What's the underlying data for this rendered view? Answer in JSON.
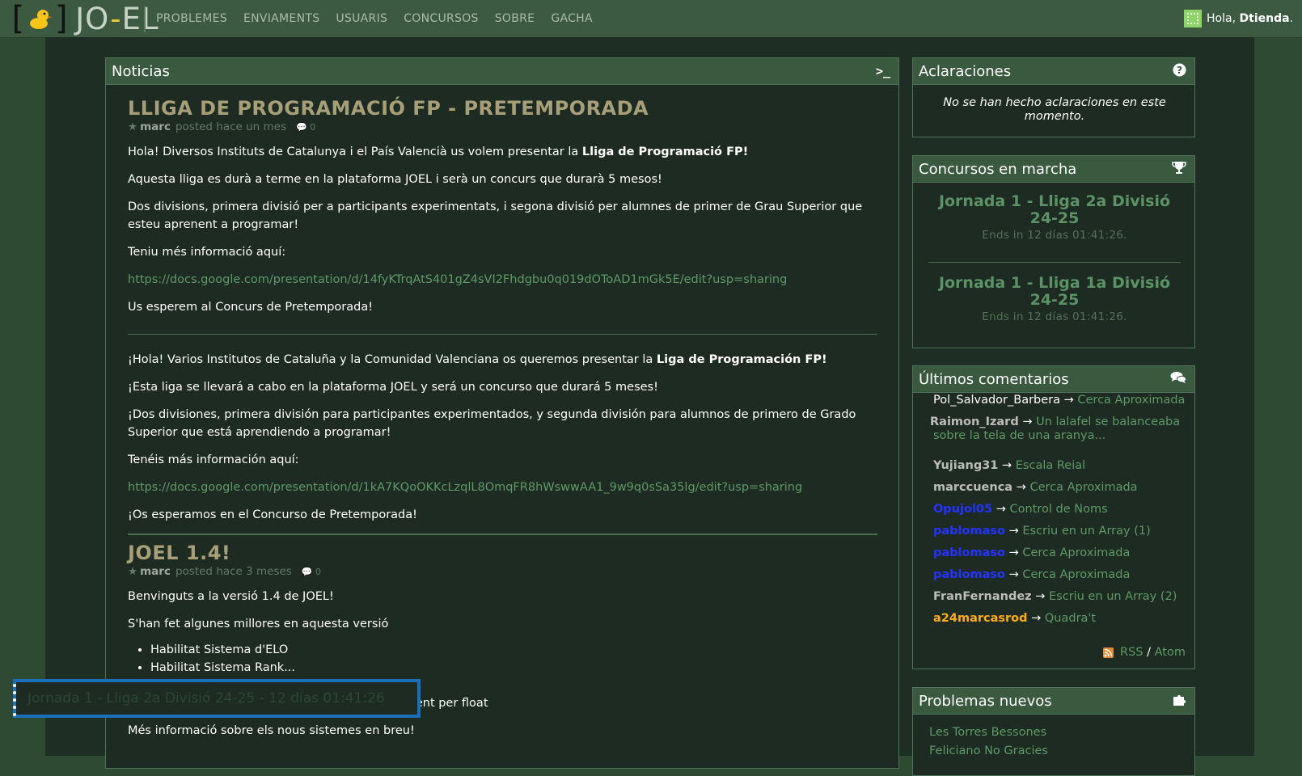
{
  "nav": {
    "logo_left": "[",
    "logo_right": "]",
    "logo_text_a": "JO",
    "logo_text_dash": "-",
    "logo_text_b": "EL",
    "links": [
      "PROBLEMES",
      "ENVIAMENTS",
      "USUARIS",
      "CONCURSOS",
      "SOBRE",
      "GACHA"
    ],
    "greeting": "Hola, ",
    "username": "Dtienda",
    "greeting_end": "."
  },
  "news": {
    "title": "Noticias",
    "icon": "terminal-icon",
    "post1": {
      "title": "LLIGA DE PROGRAMACIÓ FP - PRETEMPORADA",
      "author": "marc",
      "posted": "posted hace un mes",
      "comments": "0",
      "p1_a": "Hola! Diversos Instituts de Catalunya i el País Valencià us volem presentar la ",
      "p1_b": "Lliga de Programació FP!",
      "p2": "Aquesta lliga es durà a terme en la plataforma JOEL i serà un concurs que durarà 5 mesos!",
      "p3": "Dos divisions, primera divisió per a participants experimentats, i segona divisió per alumnes de primer de Grau Superior que esteu aprenent a programar!",
      "p4": "Teniu més informació aquí:",
      "link1": "https://docs.google.com/presentation/d/14fyKTrqAtS401gZ4sVI2Fhdgbu0q019dOToAD1mGk5E/edit?usp=sharing",
      "p5": "Us esperem al Concurs de Pretemporada!",
      "es1_a": "¡Hola! Varios Institutos de Cataluña y la Comunidad Valenciana os queremos presentar la ",
      "es1_b": "Liga de Programación FP!",
      "es2": "¡Esta liga se llevará a cabo en la plataforma JOEL y será un concurso que durará 5 meses!",
      "es3": "¡Dos divisiones, primera división para participantes experimentados, y segunda división para alumnos de primero de Grado Superior que está aprendiendo a programar!",
      "es4": "Tenéis más información aquí:",
      "link2": "https://docs.google.com/presentation/d/1kA7KQoOKKcLzqlL8OmqFR8hWswwAA1_9w9q0sSa35lg/edit?usp=sharing",
      "es5": "¡Os esperamos en el Concurso de Pretemporada!"
    },
    "post2": {
      "title": "JOEL 1.4!",
      "author": "marc",
      "posted": "posted hace 3 meses",
      "comments": "0",
      "p1": "Benvinguts a la versió 1.4 de JOEL!",
      "p2": "S'han fet algunes millores en aquesta versió",
      "items": [
        "Habilitat Sistema d'ELO",
        "Habilitat Sistema Rank...",
        "...",
        "...ent per float"
      ],
      "p3": "Més informació sobre els nous sistemes en breu!"
    }
  },
  "floating": {
    "text": "Jornada 1 - Lliga 2a Divisió 24-25 - 12 días 01:41:26"
  },
  "clarifications": {
    "title": "Aclaraciones",
    "icon": "question-icon",
    "text": "No se han hecho aclaraciones en este momento."
  },
  "contests": {
    "title": "Concursos en marcha",
    "icon": "trophy-icon",
    "items": [
      {
        "name": "Jornada 1 - Lliga 2a Divisió 24-25",
        "time": "Ends in 12 días 01:41:26."
      },
      {
        "name": "Jornada 1 - Lliga 1a Divisió 24-25",
        "time": "Ends in 12 días 01:41:26."
      }
    ]
  },
  "comments": {
    "title": "Últimos comentarios",
    "icon": "comments-icon",
    "arrow": " → ",
    "items": [
      {
        "user": "Pol_Salvador_Barbera",
        "problem": "Cerca Aproximada",
        "style": "plain"
      },
      {
        "user": "Raimon_Izard",
        "problem": "Un lalafel se balanceaba sobre la tela de una aranya...",
        "style": "gray"
      },
      {
        "user": "Yujiang31",
        "problem": "Escala Reial",
        "style": "gray"
      },
      {
        "user": "marccuenca",
        "problem": "Cerca Aproximada",
        "style": "gray"
      },
      {
        "user": "Opujol05",
        "problem": "Control de Noms",
        "style": "blue"
      },
      {
        "user": "pablomaso",
        "problem": "Escriu en un Array (1)",
        "style": "blue"
      },
      {
        "user": "pablomaso",
        "problem": "Cerca Aproximada",
        "style": "blue"
      },
      {
        "user": "pablomaso",
        "problem": "Cerca Aproximada",
        "style": "blue"
      },
      {
        "user": "FranFernandez",
        "problem": "Escriu en un Array (2)",
        "style": "gray"
      },
      {
        "user": "a24marcasrod",
        "problem": "Quadra't",
        "style": "orange"
      }
    ],
    "rss": "RSS",
    "slash": " / ",
    "atom": "Atom"
  },
  "new_problems": {
    "title": "Problemas nuevos",
    "icon": "puzzle-icon",
    "items": [
      "Les Torres Bessones",
      "Feliciano No Gracies"
    ]
  }
}
